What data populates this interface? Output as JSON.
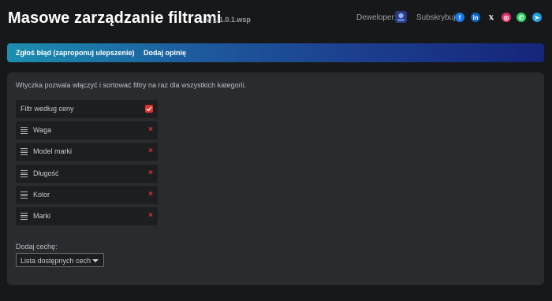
{
  "header": {
    "title": "Masowe zarządzanie filtrami",
    "version": "v. 1.1.0.1.wsp",
    "developer_label": "Deweloper:",
    "subscribe_label": "Subskrybuj:",
    "socials": [
      {
        "name": "facebook-icon",
        "glyph": "f",
        "color": "#1877f2"
      },
      {
        "name": "linkedin-icon",
        "glyph": "in",
        "color": "#0a66c2"
      },
      {
        "name": "x-icon",
        "glyph": "𝕏",
        "color": "#17181a"
      },
      {
        "name": "instagram-icon",
        "glyph": "◎",
        "color": "#e1306c"
      },
      {
        "name": "whatsapp-icon",
        "glyph": "✆",
        "color": "#25d366"
      },
      {
        "name": "telegram-icon",
        "glyph": "➤",
        "color": "#229ed9"
      }
    ]
  },
  "banner": {
    "report_bug": "Zgłoś błąd (zaproponuj ulepszenie)",
    "add_review": "Dodaj opinię"
  },
  "main": {
    "description": "Wtyczka pozwala włączyć i sortować filtry na raz dla wszystkich kategorii.",
    "price_filter": {
      "label": "Filtr według ceny",
      "checked": true
    },
    "filters": [
      {
        "label": "Waga"
      },
      {
        "label": "Model marki"
      },
      {
        "label": "Długość"
      },
      {
        "label": "Kolor"
      },
      {
        "label": "Marki"
      }
    ],
    "remove_glyph": "×",
    "add_feature_label": "Dodaj cechę:",
    "select_value": "Lista dostępnych cech"
  },
  "colors": {
    "accent_red": "#e5302a",
    "banner_start": "#1b8fb0",
    "banner_end": "#15257a"
  }
}
